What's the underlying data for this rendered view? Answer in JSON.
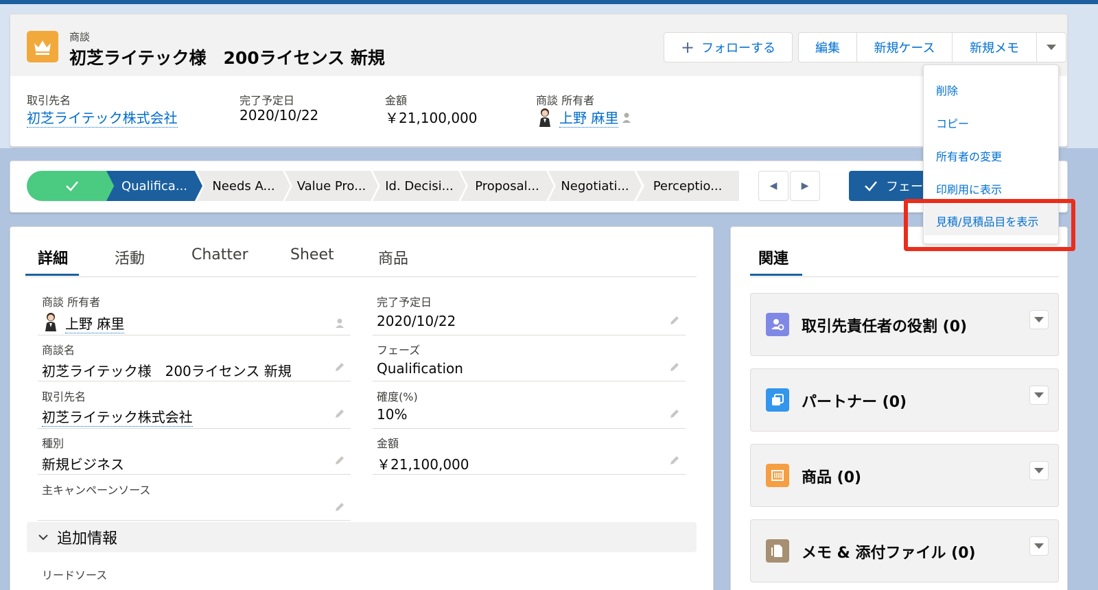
{
  "header": {
    "object_type": "商談",
    "record_title": "初芝ライテック様　200ライセンス 新規",
    "follow_label": "フォローする",
    "edit_label": "編集",
    "new_case_label": "新規ケース",
    "new_memo_label": "新規メモ",
    "highlights": [
      {
        "label": "取引先名",
        "value": "初芝ライテック株式会社"
      },
      {
        "label": "完了予定日",
        "value": "2020/10/22"
      },
      {
        "label": "金額",
        "value": "￥21,100,000"
      },
      {
        "label": "商談 所有者",
        "value": "上野 麻里"
      }
    ]
  },
  "path": {
    "stages": [
      "Qualifica...",
      "Needs A...",
      "Value Pro...",
      "Id. Decisi...",
      "Proposal...",
      "Negotiati...",
      "Perceptio..."
    ],
    "phase_button_label": "フェー"
  },
  "dropdown": {
    "items": [
      "削除",
      "コピー",
      "所有者の変更",
      "印刷用に表示",
      "見積/見積品目を表示"
    ]
  },
  "details": {
    "tabs": [
      "詳細",
      "活動",
      "Chatter",
      "Sheet",
      "商品"
    ],
    "fields": {
      "owner": {
        "label": "商談 所有者",
        "value": "上野 麻里"
      },
      "close_date": {
        "label": "完了予定日",
        "value": "2020/10/22"
      },
      "name": {
        "label": "商談名",
        "value": "初芝ライテック様　200ライセンス 新規"
      },
      "phase": {
        "label": "フェーズ",
        "value": "Qualification"
      },
      "account": {
        "label": "取引先名",
        "value": "初芝ライテック株式会社"
      },
      "probability": {
        "label": "確度(%)",
        "value": "10%"
      },
      "type": {
        "label": "種別",
        "value": "新規ビジネス"
      },
      "amount": {
        "label": "金額",
        "value": "￥21,100,000"
      },
      "campaign": {
        "label": "主キャンペーンソース",
        "value": ""
      }
    },
    "section_title": "追加情報",
    "lead_source_label": "リードソース"
  },
  "related": {
    "tab": "関連",
    "items": [
      {
        "title": "取引先責任者の役割 (0)",
        "icon": "contact-role-icon",
        "color": "#8088e6"
      },
      {
        "title": "パートナー (0)",
        "icon": "partner-icon",
        "color": "#3296ed"
      },
      {
        "title": "商品 (0)",
        "icon": "product-icon",
        "color": "#f59e42"
      },
      {
        "title": "メモ & 添付ファイル (0)",
        "icon": "file-icon",
        "color": "#a68f72"
      }
    ]
  }
}
